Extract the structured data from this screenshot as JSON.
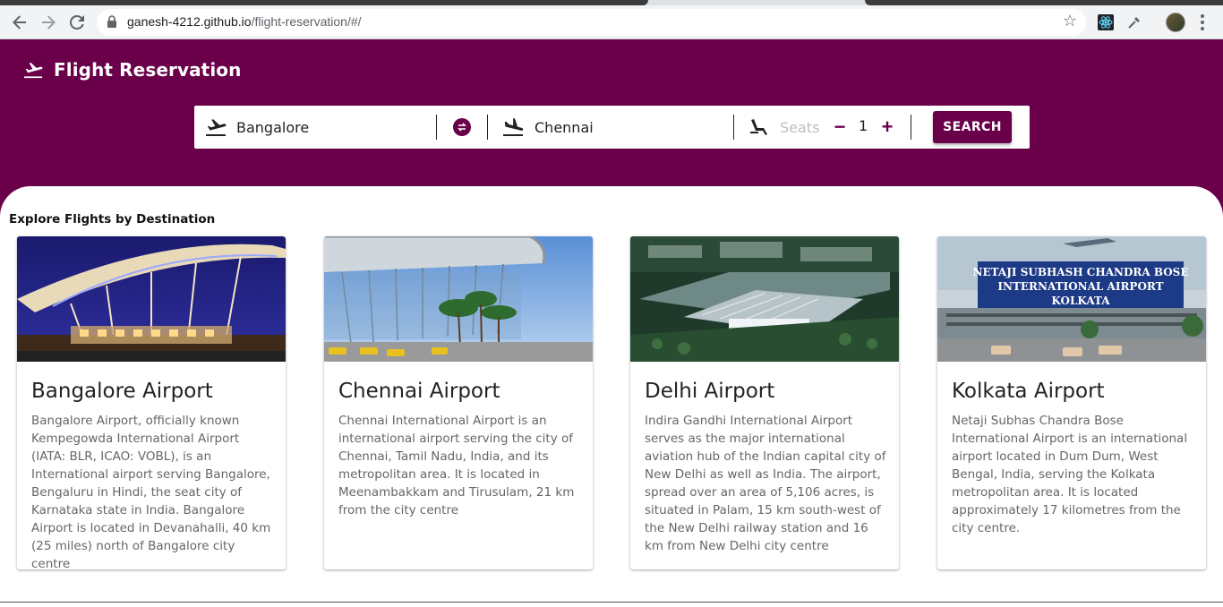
{
  "browser": {
    "url_host": "ganesh-4212.github.io",
    "url_path": "/flight-reservation/#/"
  },
  "header": {
    "title": "Flight Reservation"
  },
  "search": {
    "from_value": "Bangalore",
    "to_value": "Chennai",
    "seats_placeholder": "Seats",
    "seat_count": "1",
    "decrement_label": "−",
    "increment_label": "+",
    "search_label": "SEARCH"
  },
  "explore": {
    "title": "Explore Flights by Destination",
    "cards": [
      {
        "title": "Bangalore Airport",
        "text": "Bangalore Airport, officially known Kempegowda International Airport (IATA: BLR, ICAO: VOBL), is an International airport serving Bangalore, Bengaluru in Hindi, the seat city of Karnataka state in India. Bangalore Airport is located in Devanahalli, 40 km (25 miles) north of Bangalore city centre"
      },
      {
        "title": "Chennai Airport",
        "text": "Chennai International Airport is an international airport serving the city of Chennai, Tamil Nadu, India, and its metropolitan area. It is located in Meenambakkam and Tirusulam, 21 km from the city centre"
      },
      {
        "title": "Delhi Airport",
        "text": "Indira Gandhi International Airport serves as the major international aviation hub of the Indian capital city of New Delhi as well as India. The airport, spread over an area of 5,106 acres, is situated in Palam, 15 km south-west of the New Delhi railway station and 16 km from New Delhi city centre"
      },
      {
        "title": "Kolkata Airport",
        "text": "Netaji Subhas Chandra Bose International Airport is an international airport located in Dum Dum, West Bengal, India, serving the Kolkata metropolitan area. It is located approximately 17 kilometres from the city centre.",
        "image_banner": [
          "NETAJI SUBHASH CHANDRA BOSE",
          "INTERNATIONAL AIRPORT",
          "KOLKATA"
        ]
      }
    ]
  },
  "colors": {
    "brand": "#6a0049",
    "text_muted": "#666666"
  },
  "icons": [
    "back-icon",
    "forward-icon",
    "reload-icon",
    "lock-icon",
    "star-icon",
    "react-devtools-icon",
    "eyedropper-icon",
    "flight-takeoff-icon",
    "flight-land-icon",
    "swap-icon",
    "seat-icon"
  ]
}
